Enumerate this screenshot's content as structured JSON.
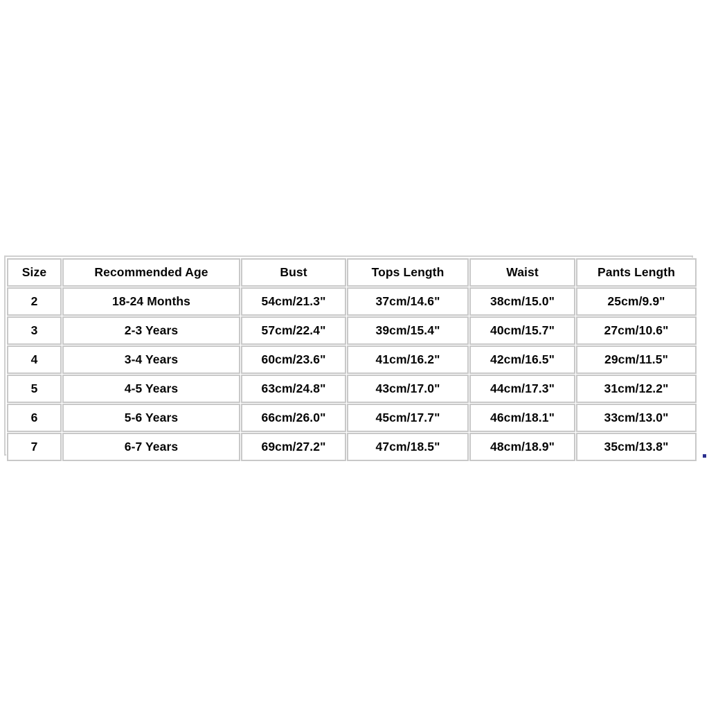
{
  "page": {
    "background_color": "#ffffff",
    "artifact_color": "#2b2f8f"
  },
  "chart_data": {
    "type": "table",
    "title": "",
    "columns": [
      "Size",
      "Recommended Age",
      "Bust",
      "Tops Length",
      "Waist",
      "Pants Length"
    ],
    "rows": [
      [
        "2",
        "18-24 Months",
        "54cm/21.3\"",
        "37cm/14.6\"",
        "38cm/15.0\"",
        "25cm/9.9\""
      ],
      [
        "3",
        "2-3 Years",
        "57cm/22.4\"",
        "39cm/15.4\"",
        "40cm/15.7\"",
        "27cm/10.6\""
      ],
      [
        "4",
        "3-4 Years",
        "60cm/23.6\"",
        "41cm/16.2\"",
        "42cm/16.5\"",
        "29cm/11.5\""
      ],
      [
        "5",
        "4-5 Years",
        "63cm/24.8\"",
        "43cm/17.0\"",
        "44cm/17.3\"",
        "31cm/12.2\""
      ],
      [
        "6",
        "5-6 Years",
        "66cm/26.0\"",
        "45cm/17.7\"",
        "46cm/18.1\"",
        "33cm/13.0\""
      ],
      [
        "7",
        "6-7 Years",
        "69cm/27.2\"",
        "47cm/18.5\"",
        "48cm/18.9\"",
        "35cm/13.8\""
      ]
    ]
  },
  "size_chart": {
    "headers": {
      "size": "Size",
      "recommended_age": "Recommended Age",
      "bust": "Bust",
      "tops_length": "Tops Length",
      "waist": "Waist",
      "pants_length": "Pants Length"
    },
    "rows": [
      {
        "size": "2",
        "recommended_age": "18-24 Months",
        "bust": "54cm/21.3\"",
        "tops_length": "37cm/14.6\"",
        "waist": "38cm/15.0\"",
        "pants_length": "25cm/9.9\""
      },
      {
        "size": "3",
        "recommended_age": "2-3 Years",
        "bust": "57cm/22.4\"",
        "tops_length": "39cm/15.4\"",
        "waist": "40cm/15.7\"",
        "pants_length": "27cm/10.6\""
      },
      {
        "size": "4",
        "recommended_age": "3-4 Years",
        "bust": "60cm/23.6\"",
        "tops_length": "41cm/16.2\"",
        "waist": "42cm/16.5\"",
        "pants_length": "29cm/11.5\""
      },
      {
        "size": "5",
        "recommended_age": "4-5 Years",
        "bust": "63cm/24.8\"",
        "tops_length": "43cm/17.0\"",
        "waist": "44cm/17.3\"",
        "pants_length": "31cm/12.2\""
      },
      {
        "size": "6",
        "recommended_age": "5-6 Years",
        "bust": "66cm/26.0\"",
        "tops_length": "45cm/17.7\"",
        "waist": "46cm/18.1\"",
        "pants_length": "33cm/13.0\""
      },
      {
        "size": "7",
        "recommended_age": "6-7 Years",
        "bust": "69cm/27.2\"",
        "tops_length": "47cm/18.5\"",
        "waist": "48cm/18.9\"",
        "pants_length": "35cm/13.8\""
      }
    ]
  }
}
